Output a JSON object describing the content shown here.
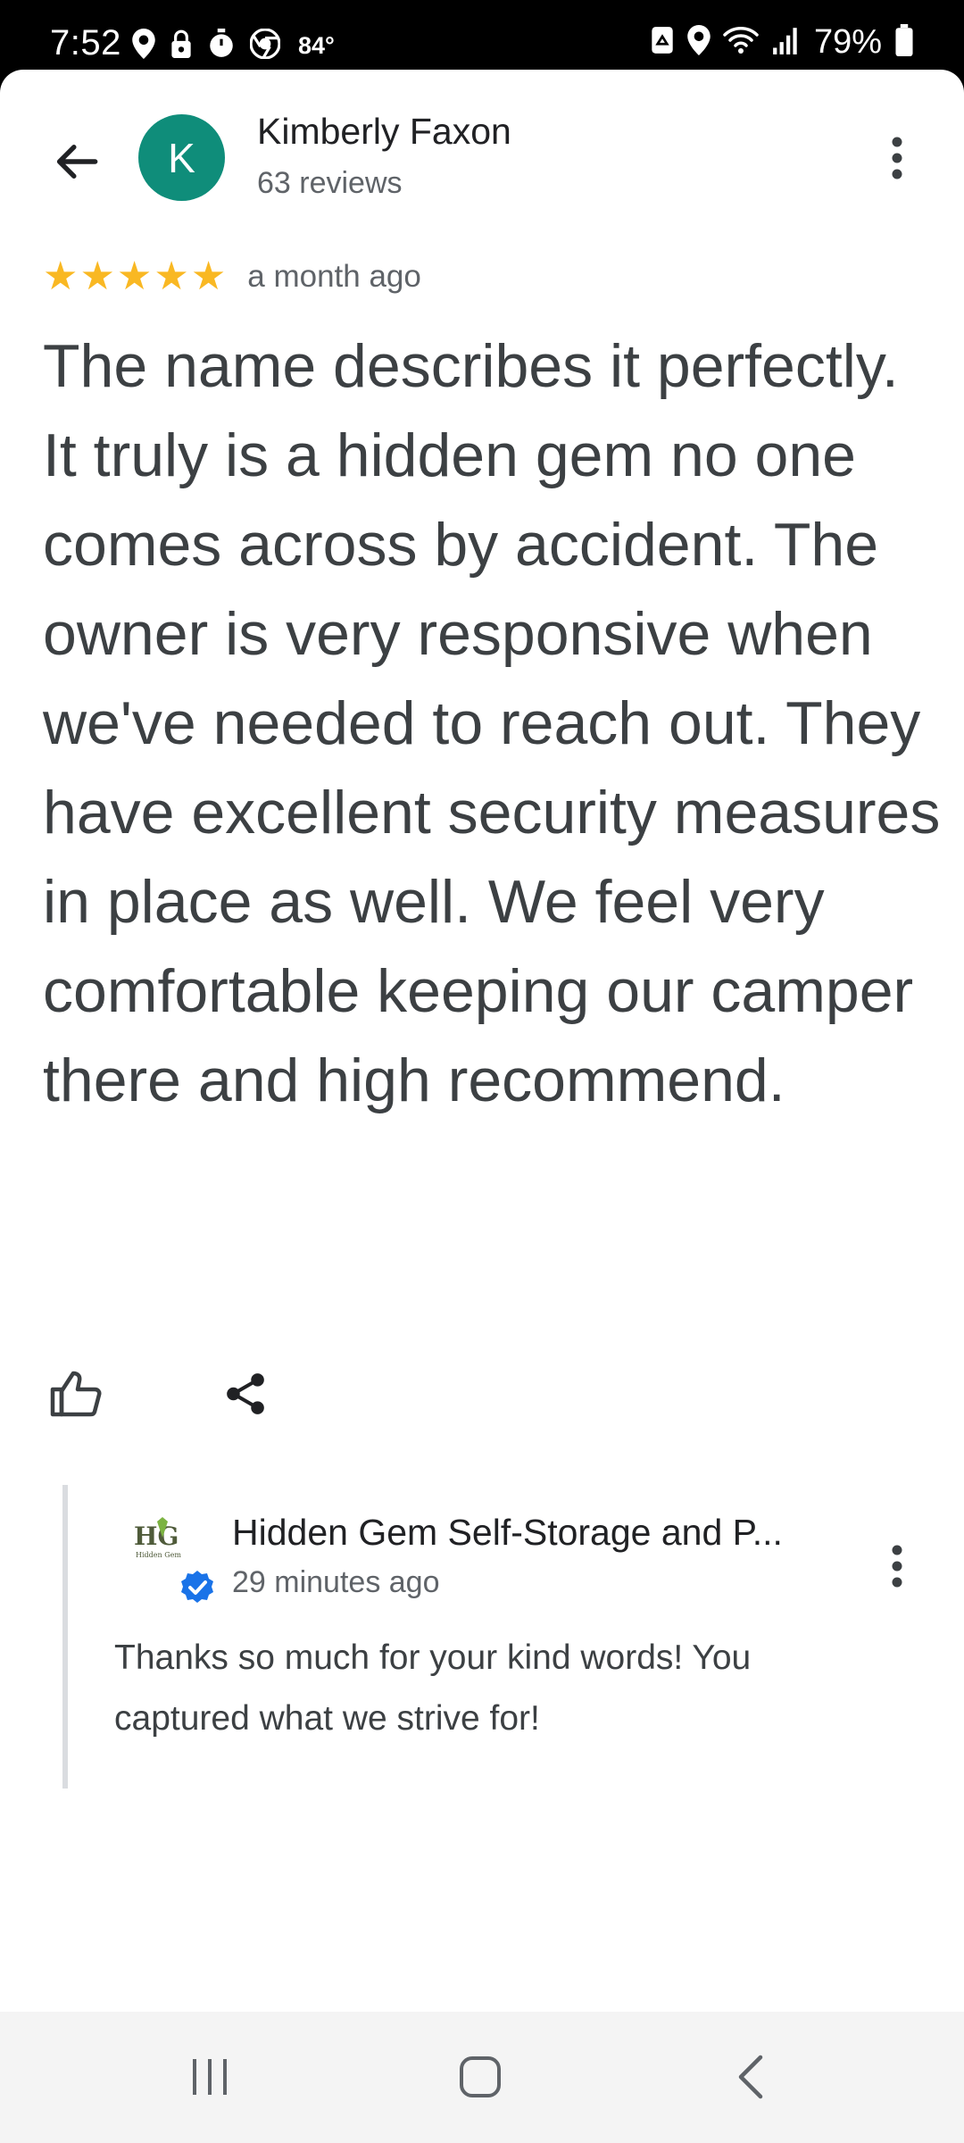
{
  "status_bar": {
    "time": "7:52",
    "temperature": "84°",
    "battery": "79%",
    "left_icons": [
      "location-icon",
      "lock-icon",
      "timer-icon",
      "chrome-icon"
    ],
    "right_icons": [
      "recycle-icon",
      "location-icon",
      "wifi-icon",
      "signal-icon",
      "battery-icon"
    ]
  },
  "reviewer": {
    "initial": "K",
    "name": "Kimberly Faxon",
    "review_count": "63 reviews",
    "avatar_color": "#0f8d7a"
  },
  "review": {
    "rating": 5,
    "max_rating": 5,
    "star_color": "#f9b823",
    "time_ago": "a month ago",
    "text": "The name describes it perfectly.  It truly is a hidden gem no one comes across by accident.  The owner is very responsive when we've needed to reach out.  They have excellent security measures in place as well.  We feel very comfortable keeping our camper there and high recommend."
  },
  "actions": {
    "like_icon": "thumbs-up-icon",
    "share_icon": "share-icon"
  },
  "owner_reply": {
    "business_name": "Hidden Gem Self-Storage and P...",
    "logo_text": "HG",
    "logo_subtext": "Hidden Gem",
    "time_ago": "29 minutes ago",
    "text": "Thanks so much for your kind words! You captured what we strive for!",
    "verified_color": "#1a73e8"
  },
  "nav_bar": {
    "buttons": [
      "recents-icon",
      "home-icon",
      "back-icon"
    ]
  }
}
